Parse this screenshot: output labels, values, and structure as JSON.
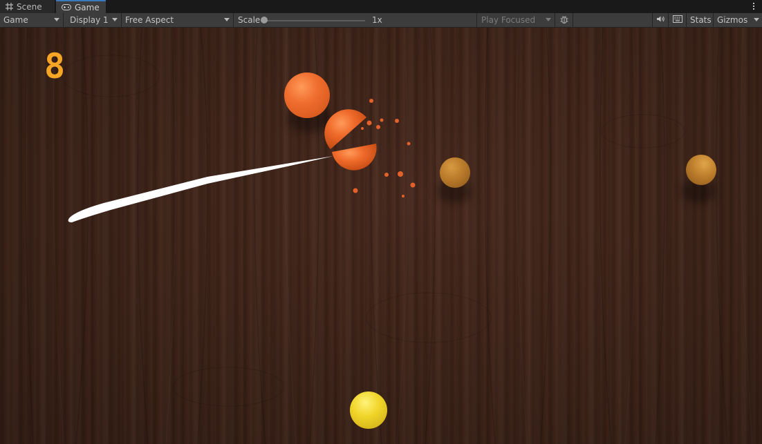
{
  "tabs": [
    {
      "label": "Scene",
      "icon": "grid-icon",
      "active": false
    },
    {
      "label": "Game",
      "icon": "gamepad-icon",
      "active": true
    }
  ],
  "toolbar": {
    "view_mode": "Game",
    "display": "Display 1",
    "aspect": "Free Aspect",
    "scale_label": "Scale",
    "scale_value": "1x",
    "play_mode": "Play Focused",
    "stats_label": "Stats",
    "gizmos_label": "Gizmos",
    "icons": [
      "bug-icon",
      "speaker-icon",
      "keyboard-icon",
      "kebab-menu-icon"
    ]
  },
  "game": {
    "score": "8",
    "colors": {
      "score": "#f6a524",
      "orange_fruit": "#e96a2c",
      "brown_fruit": "#b97a2a",
      "yellow_fruit": "#f1d62a",
      "table": "#3f2419",
      "slash_trail": "#ffffff"
    }
  }
}
